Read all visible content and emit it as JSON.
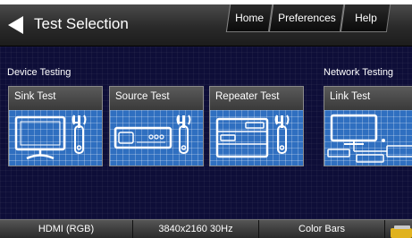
{
  "header": {
    "title": "Test Selection",
    "tabs": {
      "home": "Home",
      "preferences": "Preferences",
      "help": "Help"
    }
  },
  "sections": {
    "device_testing": "Device Testing",
    "network_testing": "Network Testing"
  },
  "cards": {
    "sink": "Sink Test",
    "source": "Source Test",
    "repeater": "Repeater Test",
    "link": "Link Test"
  },
  "status": {
    "format": "HDMI (RGB)",
    "resolution": "3840x2160 30Hz",
    "pattern": "Color Bars"
  },
  "colors": {
    "background": "#0e0e38",
    "card_art": "#2f6fc0",
    "header": "#2a2a2a"
  }
}
